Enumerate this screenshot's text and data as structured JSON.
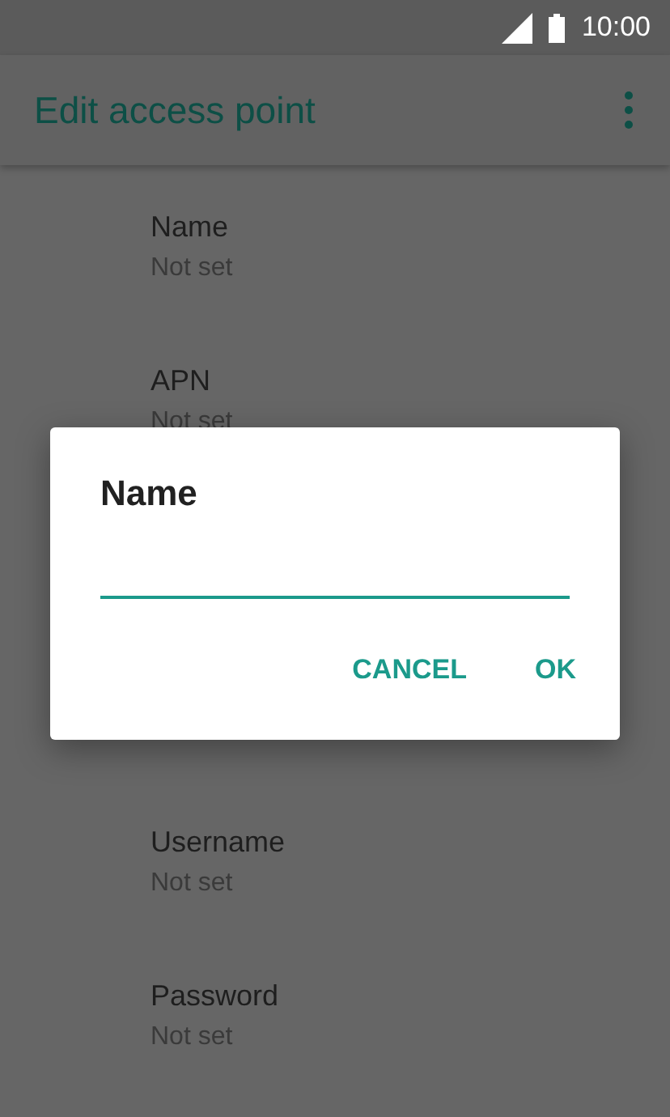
{
  "status_bar": {
    "time": "10:00"
  },
  "app_bar": {
    "title": "Edit access point"
  },
  "settings_top": [
    {
      "label": "Name",
      "value": "Not set"
    },
    {
      "label": "APN",
      "value": "Not set"
    }
  ],
  "settings_bottom": [
    {
      "label": "Username",
      "value": "Not set"
    },
    {
      "label": "Password",
      "value": "Not set"
    }
  ],
  "dialog": {
    "title": "Name",
    "buttons": [
      "CANCEL",
      "OK"
    ]
  }
}
